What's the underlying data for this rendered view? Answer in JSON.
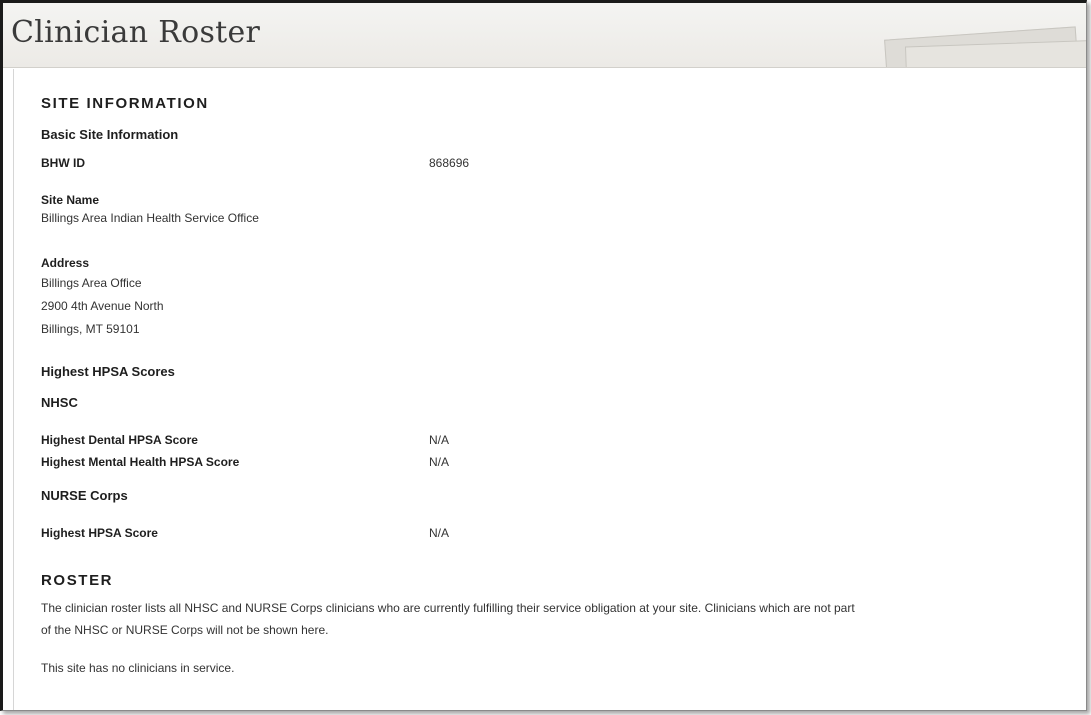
{
  "page": {
    "title": "Clinician Roster"
  },
  "site_information": {
    "heading": "SITE INFORMATION",
    "basic_heading": "Basic Site Information",
    "bhw_id_label": "BHW ID",
    "bhw_id_value": "868696",
    "site_name_label": "Site Name",
    "site_name_value": "Billings Area Indian Health Service Office",
    "address_label": "Address",
    "address_lines": [
      "Billings Area Office",
      "2900 4th Avenue North",
      "Billings, MT 59101"
    ]
  },
  "hpsa": {
    "heading": "Highest HPSA Scores",
    "nhsc_heading": "NHSC",
    "dental_label": "Highest Dental HPSA Score",
    "dental_value": "N/A",
    "mental_label": "Highest Mental Health HPSA Score",
    "mental_value": "N/A",
    "nurse_heading": "NURSE Corps",
    "nurse_label": "Highest HPSA Score",
    "nurse_value": "N/A"
  },
  "roster": {
    "heading": "ROSTER",
    "description_line1": "The clinician roster lists all NHSC and NURSE Corps clinicians who are currently fulfilling their service obligation at your site. Clinicians which are not part",
    "description_line2": "of the NHSC or NURSE Corps will not be shown here.",
    "empty_message": "This site has no clinicians in service."
  }
}
